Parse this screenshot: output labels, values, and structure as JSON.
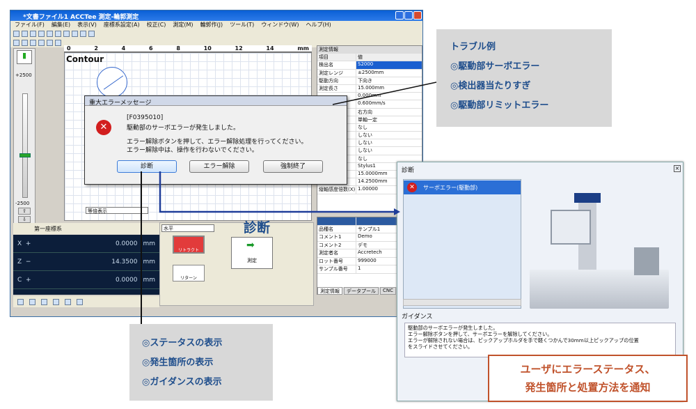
{
  "window": {
    "title": "*文書ファイル1 ACCTee 測定-輪郭測定",
    "menu": [
      "ファイル(F)",
      "編集(E)",
      "表示(V)",
      "座標系設定(A)",
      "校正(C)",
      "測定(M)",
      "輪郭作(J)",
      "ツール(T)",
      "ウィンドウ(W)",
      "ヘルプ(H)"
    ]
  },
  "gauge": {
    "top": "+2500",
    "bottom": "-2500",
    "unit": "mm"
  },
  "graph": {
    "label": "Contour",
    "ruler_ticks": [
      "0",
      "2",
      "4",
      "6",
      "8",
      "10",
      "12",
      "14"
    ],
    "ruler_unit": "mm",
    "bottom_select": "等倍表示"
  },
  "measure_info": {
    "title": "測定情報",
    "header": [
      "項目",
      "値"
    ],
    "rows": [
      [
        "検出名",
        "S2000"
      ],
      [
        "測定レンジ",
        "±2500mm"
      ],
      [
        "駆動方向",
        "下向き"
      ],
      [
        "測定長さ",
        "15.000mm"
      ],
      [
        "",
        "0.000mm"
      ],
      [
        "",
        "0.600mm/s"
      ],
      [
        "",
        "右方向"
      ],
      [
        "",
        "単軸一定"
      ],
      [
        "",
        "なし"
      ],
      [
        "",
        "しない"
      ],
      [
        "",
        "しない"
      ],
      [
        "",
        "しない"
      ],
      [
        "",
        "なし"
      ],
      [
        "",
        "Stylus1"
      ],
      [
        "",
        "15.0000mm"
      ],
      [
        "",
        "14.2500mm"
      ],
      [
        "縦軸感度倍数(X)",
        "1.00000"
      ]
    ]
  },
  "sample_info": {
    "rows": [
      [
        "品種名",
        "サンプル1"
      ],
      [
        "コメント1",
        "Demo"
      ],
      [
        "コメント2",
        "デモ"
      ],
      [
        "測定者名",
        "Accretech"
      ],
      [
        "ロット番号",
        "999000"
      ],
      [
        "サンプル番号",
        "1"
      ]
    ],
    "tabs": [
      "測定情報",
      "データプール",
      "CNC"
    ]
  },
  "coord": {
    "label": "第一座標系",
    "rows": [
      {
        "axis": "X",
        "sign": "+",
        "value": "0.0000",
        "unit": "mm"
      },
      {
        "axis": "Z",
        "sign": "−",
        "value": "14.3500",
        "unit": "mm"
      },
      {
        "axis": "C",
        "sign": "+",
        "value": "0.0000",
        "unit": "mm"
      }
    ]
  },
  "control": {
    "select": "水平",
    "button_red": "リトラクト",
    "button_return": "リターン",
    "diag_label": "診断",
    "measure_button": "測定"
  },
  "dialog": {
    "title": "重大エラーメッセージ",
    "code": "[F0395010]",
    "line1": "駆動部のサーボエラーが発生しました。",
    "line2": "エラー解除ボタンを押して、エラー解除処理を行ってください。",
    "line3": "エラー解除中は、操作を行わないでください。",
    "btn_diagnose": "診断",
    "btn_clear": "エラー解除",
    "btn_force": "強制終了"
  },
  "diag_window": {
    "title": "診断",
    "item": "サーボエラー(駆動部)",
    "guidance_title": "ガイダンス",
    "guidance_lines": [
      "駆動部のサーボエラーが発生しました。",
      "エラー解除ボタンを押して、サーボエラーを解除してください。",
      "エラーが解除されない場合は、ピックアップホルダを手で軽くつかんで30mm以上ピックアップの位置",
      "をスライドさせてください。"
    ]
  },
  "callouts": {
    "trouble": [
      "トラブル例",
      "◎駆動部サーボエラー",
      "◎検出器当たりすぎ",
      "◎駆動部リミットエラー"
    ],
    "status": [
      "◎ステータスの表示",
      "◎発生箇所の表示",
      "◎ガイダンスの表示"
    ],
    "notify": [
      "ユーザにエラーステータス、",
      "発生箇所と処置方法を通知"
    ]
  }
}
